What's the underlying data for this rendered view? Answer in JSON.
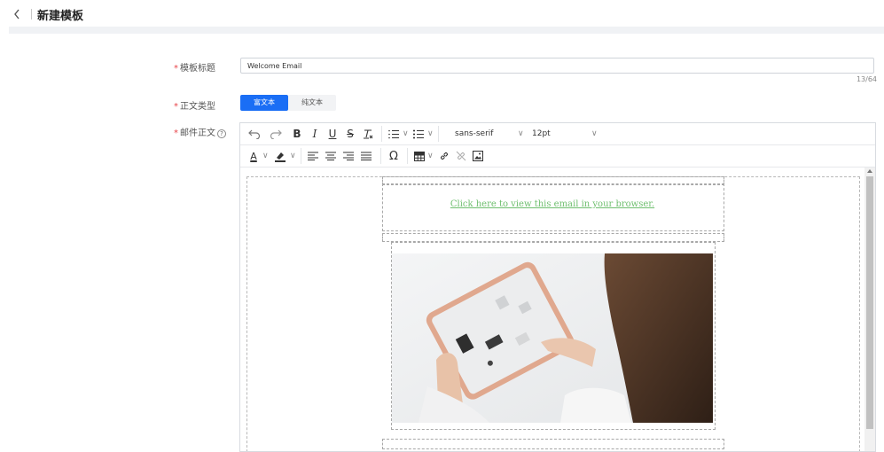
{
  "header": {
    "back_icon": "chevron-left-icon",
    "title": "新建模板"
  },
  "form": {
    "title_field": {
      "label": "模板标题",
      "value": "Welcome Email",
      "count": "13/64"
    },
    "type_field": {
      "label": "正文类型",
      "options": [
        "富文本",
        "纯文本"
      ],
      "selected": "富文本"
    },
    "body_field": {
      "label": "邮件正文",
      "help_icon": "help-circle-icon",
      "help_glyph": "?"
    }
  },
  "toolbar": {
    "row1": [
      "undo-icon",
      "redo-icon",
      "bold-icon",
      "italic-icon",
      "underline-icon",
      "strikethrough-icon",
      "clear-format-icon",
      "numbered-list-icon",
      "bullet-list-icon"
    ],
    "bold": "B",
    "italic": "I",
    "underline": "U",
    "strike": "S",
    "font_family": "sans-serif",
    "font_size": "12pt",
    "row2": [
      "text-color-icon",
      "highlight-icon",
      "align-left-icon",
      "align-center-icon",
      "align-right-icon",
      "justify-icon",
      "special-char-icon",
      "table-icon",
      "link-icon",
      "unlink-icon",
      "image-icon"
    ],
    "text_color": "A",
    "special_char": "Ω"
  },
  "content": {
    "view_link": "Click here to view this email in your browser.",
    "hero_image": "woman holding tablet photo"
  },
  "colors": {
    "primary": "#1a6ef5",
    "required": "#e8454a",
    "link": "#6fbf6f"
  }
}
